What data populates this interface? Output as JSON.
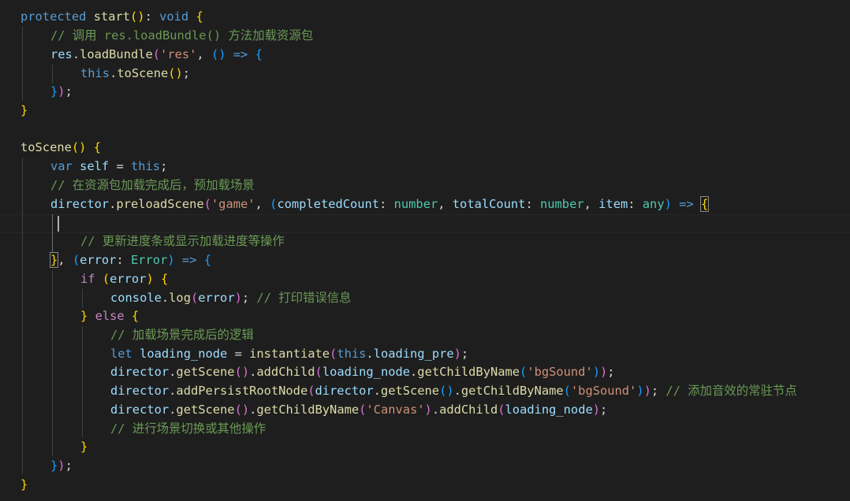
{
  "lines": [
    [
      [
        "kw",
        "protected"
      ],
      [
        "p",
        " "
      ],
      [
        "fn",
        "start"
      ],
      [
        "b1",
        "()"
      ],
      [
        "p",
        ": "
      ],
      [
        "kw",
        "void"
      ],
      [
        "p",
        " "
      ],
      [
        "b1",
        "{"
      ]
    ],
    [
      [
        "cmt",
        "// 调用 res.loadBundle() 方法加载资源包"
      ]
    ],
    [
      [
        "var",
        "res"
      ],
      [
        "p",
        "."
      ],
      [
        "fn",
        "loadBundle"
      ],
      [
        "b2",
        "("
      ],
      [
        "str",
        "'res'"
      ],
      [
        "p",
        ", "
      ],
      [
        "b3",
        "()"
      ],
      [
        "p",
        " "
      ],
      [
        "kw",
        "=>"
      ],
      [
        "p",
        " "
      ],
      [
        "b3",
        "{"
      ]
    ],
    [
      [
        "kw",
        "this"
      ],
      [
        "p",
        "."
      ],
      [
        "fn",
        "toScene"
      ],
      [
        "b1",
        "()"
      ],
      [
        "p",
        ";"
      ]
    ],
    [
      [
        "b3",
        "}"
      ],
      [
        "b2",
        ")"
      ],
      [
        "p",
        ";"
      ]
    ],
    [
      [
        "b1",
        "}"
      ]
    ],
    [],
    [
      [
        "fn",
        "toScene"
      ],
      [
        "b1",
        "()"
      ],
      [
        "p",
        " "
      ],
      [
        "b1",
        "{"
      ]
    ],
    [
      [
        "kw",
        "var"
      ],
      [
        "p",
        " "
      ],
      [
        "var",
        "self"
      ],
      [
        "p",
        " = "
      ],
      [
        "kw",
        "this"
      ],
      [
        "p",
        ";"
      ]
    ],
    [
      [
        "cmt",
        "// 在资源包加载完成后，预加载场景"
      ]
    ],
    [
      [
        "var",
        "director"
      ],
      [
        "p",
        "."
      ],
      [
        "fn",
        "preloadScene"
      ],
      [
        "b2",
        "("
      ],
      [
        "str",
        "'game'"
      ],
      [
        "p",
        ", "
      ],
      [
        "b3",
        "("
      ],
      [
        "var",
        "completedCount"
      ],
      [
        "p",
        ": "
      ],
      [
        "typ",
        "number"
      ],
      [
        "p",
        ", "
      ],
      [
        "var",
        "totalCount"
      ],
      [
        "p",
        ": "
      ],
      [
        "typ",
        "number"
      ],
      [
        "p",
        ", "
      ],
      [
        "var",
        "item"
      ],
      [
        "p",
        ": "
      ],
      [
        "typ",
        "any"
      ],
      [
        "b3",
        ")"
      ],
      [
        "p",
        " "
      ],
      [
        "kw",
        "=>"
      ],
      [
        "p",
        " "
      ],
      [
        "b1 match",
        "{"
      ]
    ],
    [],
    [
      [
        "cmt",
        "// 更新进度条或显示加载进度等操作"
      ]
    ],
    [
      [
        "b1 match",
        "}"
      ],
      [
        "p",
        ", "
      ],
      [
        "b3",
        "("
      ],
      [
        "var",
        "error"
      ],
      [
        "p",
        ": "
      ],
      [
        "typ",
        "Error"
      ],
      [
        "b3",
        ")"
      ],
      [
        "p",
        " "
      ],
      [
        "kw",
        "=>"
      ],
      [
        "p",
        " "
      ],
      [
        "b3",
        "{"
      ]
    ],
    [
      [
        "ctl",
        "if"
      ],
      [
        "p",
        " "
      ],
      [
        "b1",
        "("
      ],
      [
        "var",
        "error"
      ],
      [
        "b1",
        ")"
      ],
      [
        "p",
        " "
      ],
      [
        "b1",
        "{"
      ]
    ],
    [
      [
        "var",
        "console"
      ],
      [
        "p",
        "."
      ],
      [
        "fn",
        "log"
      ],
      [
        "b2",
        "("
      ],
      [
        "var",
        "error"
      ],
      [
        "b2",
        ")"
      ],
      [
        "p",
        "; "
      ],
      [
        "cmt",
        "// 打印错误信息"
      ]
    ],
    [
      [
        "b1",
        "}"
      ],
      [
        "p",
        " "
      ],
      [
        "ctl",
        "else"
      ],
      [
        "p",
        " "
      ],
      [
        "b1",
        "{"
      ]
    ],
    [
      [
        "cmt",
        "// 加载场景完成后的逻辑"
      ]
    ],
    [
      [
        "kw",
        "let"
      ],
      [
        "p",
        " "
      ],
      [
        "var",
        "loading_node"
      ],
      [
        "p",
        " = "
      ],
      [
        "fn",
        "instantiate"
      ],
      [
        "b2",
        "("
      ],
      [
        "kw",
        "this"
      ],
      [
        "p",
        "."
      ],
      [
        "var",
        "loading_pre"
      ],
      [
        "b2",
        ")"
      ],
      [
        "p",
        ";"
      ]
    ],
    [
      [
        "var",
        "director"
      ],
      [
        "p",
        "."
      ],
      [
        "fn",
        "getScene"
      ],
      [
        "b2",
        "()"
      ],
      [
        "p",
        "."
      ],
      [
        "fn",
        "addChild"
      ],
      [
        "b2",
        "("
      ],
      [
        "var",
        "loading_node"
      ],
      [
        "p",
        "."
      ],
      [
        "fn",
        "getChildByName"
      ],
      [
        "b3",
        "("
      ],
      [
        "str",
        "'bgSound'"
      ],
      [
        "b3",
        ")"
      ],
      [
        "b2",
        ")"
      ],
      [
        "p",
        ";"
      ]
    ],
    [
      [
        "var",
        "director"
      ],
      [
        "p",
        "."
      ],
      [
        "fn",
        "addPersistRootNode"
      ],
      [
        "b2",
        "("
      ],
      [
        "var",
        "director"
      ],
      [
        "p",
        "."
      ],
      [
        "fn",
        "getScene"
      ],
      [
        "b3",
        "()"
      ],
      [
        "p",
        "."
      ],
      [
        "fn",
        "getChildByName"
      ],
      [
        "b3",
        "("
      ],
      [
        "str",
        "'bgSound'"
      ],
      [
        "b3",
        ")"
      ],
      [
        "b2",
        ")"
      ],
      [
        "p",
        "; "
      ],
      [
        "cmt",
        "// 添加音效的常驻节点"
      ]
    ],
    [
      [
        "var",
        "director"
      ],
      [
        "p",
        "."
      ],
      [
        "fn",
        "getScene"
      ],
      [
        "b2",
        "()"
      ],
      [
        "p",
        "."
      ],
      [
        "fn",
        "getChildByName"
      ],
      [
        "b2",
        "("
      ],
      [
        "str",
        "'Canvas'"
      ],
      [
        "b2",
        ")"
      ],
      [
        "p",
        "."
      ],
      [
        "fn",
        "addChild"
      ],
      [
        "b2",
        "("
      ],
      [
        "var",
        "loading_node"
      ],
      [
        "b2",
        ")"
      ],
      [
        "p",
        ";"
      ]
    ],
    [
      [
        "cmt",
        "// 进行场景切换或其他操作"
      ]
    ],
    [
      [
        "b1",
        "}"
      ]
    ],
    [
      [
        "b3",
        "}"
      ],
      [
        "b2",
        ")"
      ],
      [
        "p",
        ";"
      ]
    ],
    [
      [
        "b1",
        "}"
      ]
    ]
  ]
}
